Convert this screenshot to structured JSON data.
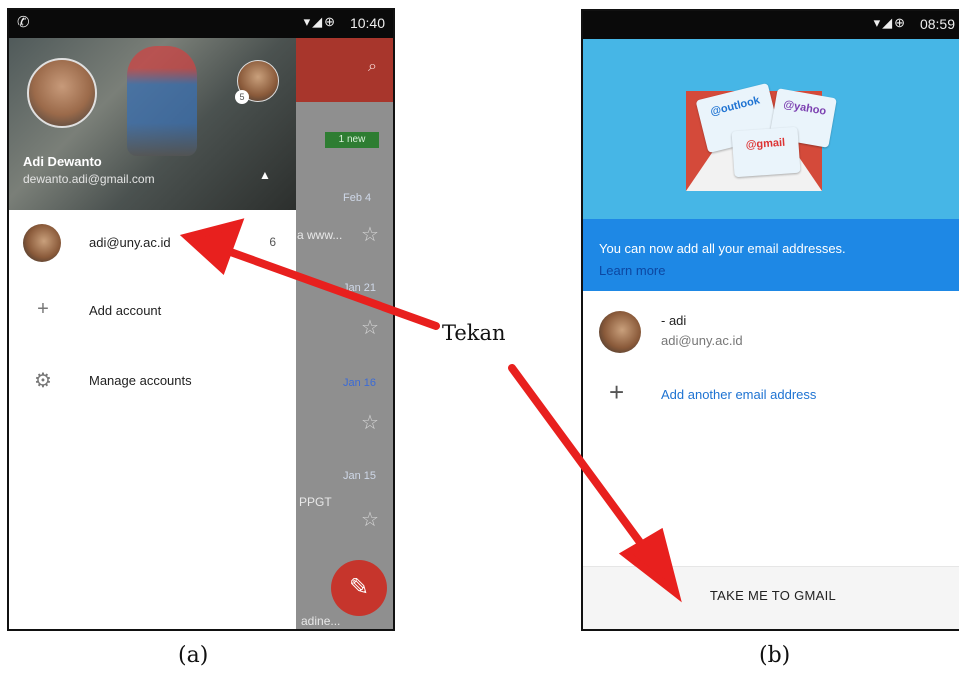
{
  "phone_a": {
    "status_time": "10:40",
    "drawer": {
      "user_name": "Adi Dewanto",
      "user_email": "dewanto.adi@gmail.com",
      "small_avatar_badge": "5",
      "items": [
        {
          "label": "adi@uny.ac.id",
          "count": "6",
          "icon": "avatar"
        },
        {
          "label": "Add account",
          "icon": "plus-icon"
        },
        {
          "label": "Manage accounts",
          "icon": "gear-icon"
        }
      ]
    },
    "background_inbox": {
      "badge": "1 new",
      "dates": [
        "Feb 4",
        "Jan 21",
        "Jan 16",
        "Jan 15"
      ],
      "fragments": [
        "a www...",
        "PPGT",
        "adine..."
      ]
    }
  },
  "phone_b": {
    "status_time": "08:59",
    "hero_cards": [
      "@outlook",
      "@yahoo",
      "@gmail"
    ],
    "banner": {
      "text": "You can now add all your email addresses.",
      "link": "Learn more"
    },
    "account": {
      "name": "- adi",
      "email": "adi@uny.ac.id"
    },
    "add_label": "Add another email address",
    "footer_button": "TAKE ME TO GMAIL"
  },
  "annotation": {
    "label": "Tekan",
    "caption_a": "(a)",
    "caption_b": "(b)",
    "arrow_color": "#e8201e"
  }
}
